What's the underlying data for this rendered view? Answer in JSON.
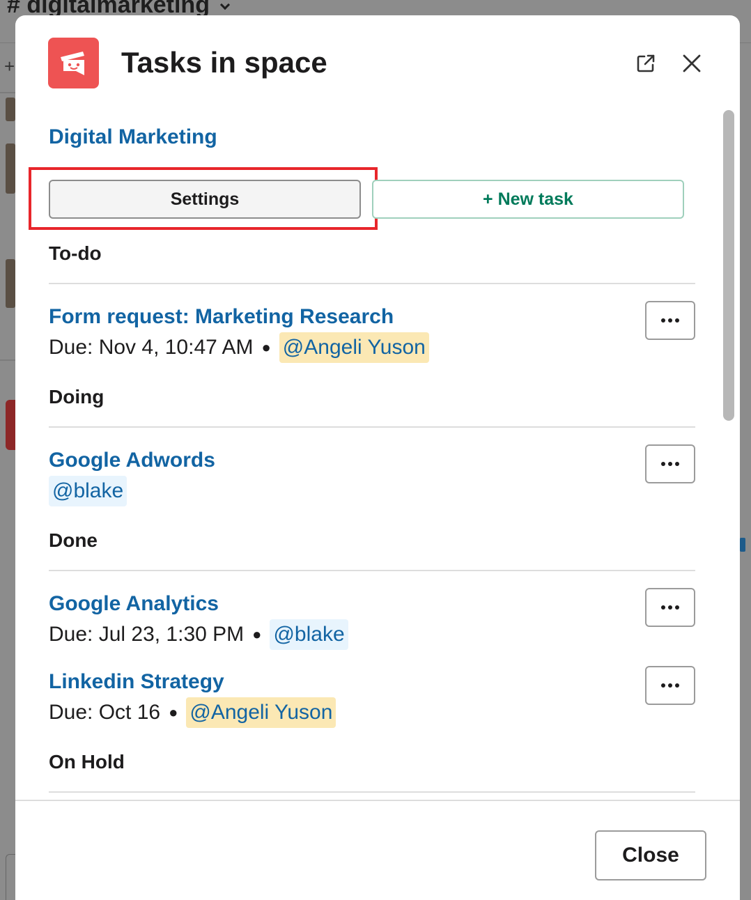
{
  "background": {
    "channel_name": "# digitalmarketing",
    "add_icon": "+"
  },
  "modal": {
    "title": "Tasks in space",
    "app_icon": "tasks-app-logo-icon",
    "popout_icon": "external-link-icon",
    "close_icon": "close-icon",
    "space_name": "Digital Marketing",
    "settings_label": "Settings",
    "new_task_label": "+ New task",
    "footer_close_label": "Close"
  },
  "sections": [
    {
      "title": "To-do",
      "tasks": [
        {
          "title": "Form request: Marketing Research",
          "due": "Due: Nov 4, 10:47 AM",
          "assignee": "@Angeli Yuson",
          "assignee_is_me": true
        }
      ]
    },
    {
      "title": "Doing",
      "tasks": [
        {
          "title": "Google Adwords",
          "due": "",
          "assignee": "@blake",
          "assignee_is_me": false
        }
      ]
    },
    {
      "title": "Done",
      "tasks": [
        {
          "title": "Google Analytics",
          "due": "Due: Jul 23, 1:30 PM",
          "assignee": "@blake",
          "assignee_is_me": false
        },
        {
          "title": "Linkedin Strategy",
          "due": "Due: Oct 16",
          "assignee": "@Angeli Yuson",
          "assignee_is_me": true
        }
      ]
    },
    {
      "title": "On Hold",
      "tasks": []
    }
  ],
  "colors": {
    "link": "#1264a3",
    "green": "#007a5a",
    "logo_red": "#ee5353",
    "highlight_red": "#e8262b",
    "mention_me_bg": "#fbe8b4",
    "mention_other_bg": "#e8f4fd"
  }
}
